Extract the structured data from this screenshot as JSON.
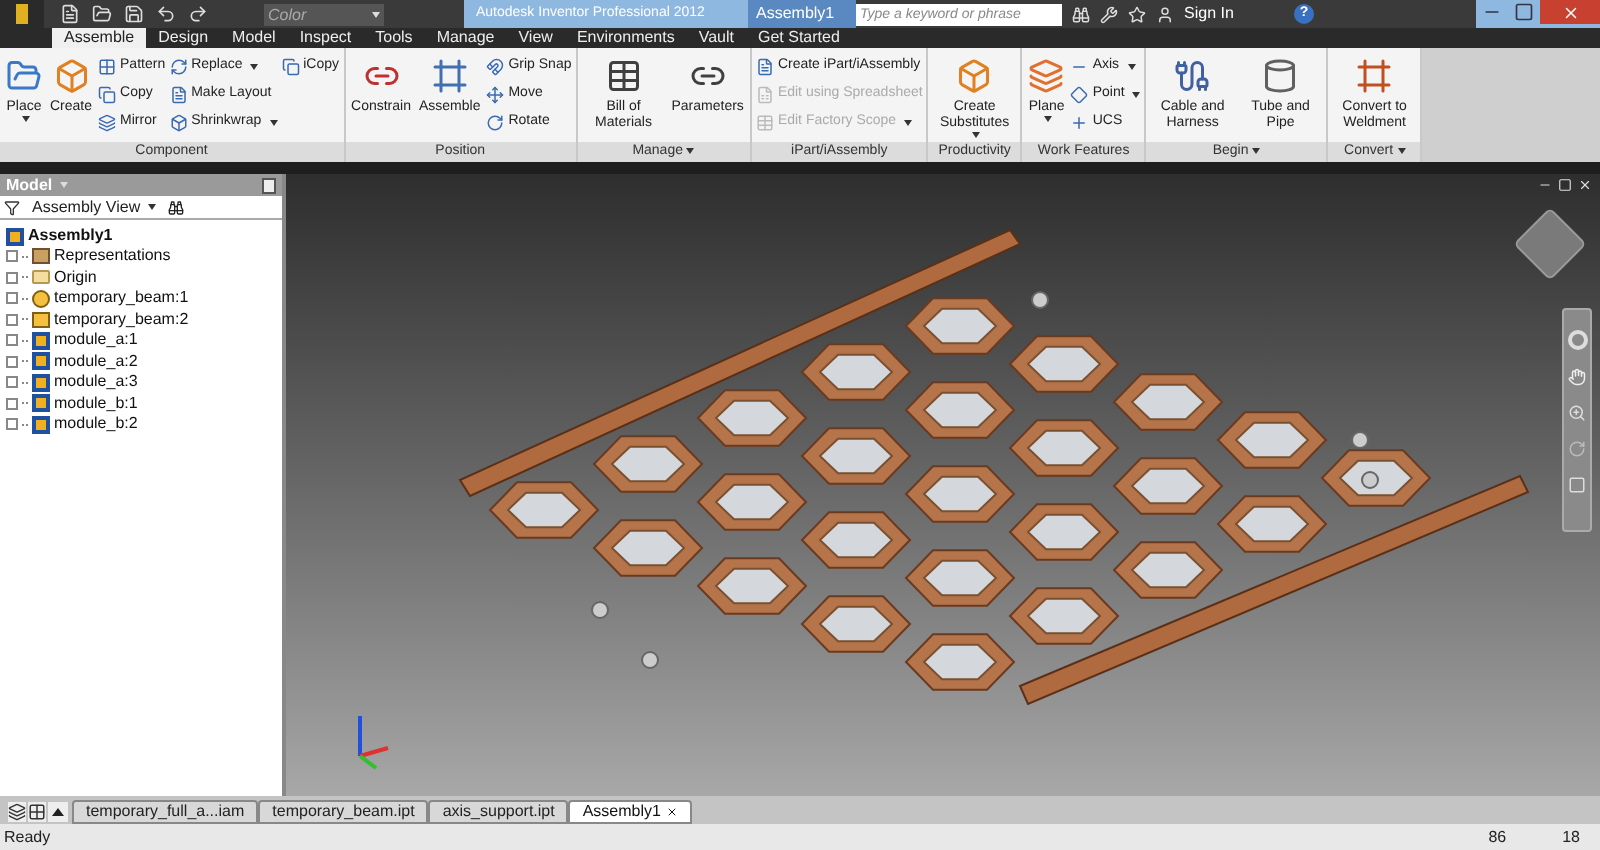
{
  "title_bar": {
    "color_field": "Color",
    "app_title": "Autodesk Inventor Professional 2012",
    "document_title": "Assembly1",
    "search_placeholder": "Type a keyword or phrase",
    "sign_in": "Sign In",
    "help": "?"
  },
  "ribbon_tabs": [
    {
      "label": "Assemble",
      "selected": true
    },
    {
      "label": "Design",
      "selected": false
    },
    {
      "label": "Model",
      "selected": false
    },
    {
      "label": "Inspect",
      "selected": false
    },
    {
      "label": "Tools",
      "selected": false
    },
    {
      "label": "Manage",
      "selected": false
    },
    {
      "label": "View",
      "selected": false
    },
    {
      "label": "Environments",
      "selected": false
    },
    {
      "label": "Vault",
      "selected": false
    },
    {
      "label": "Get Started",
      "selected": false
    }
  ],
  "panels": [
    {
      "title": "Component",
      "menu": false,
      "tools": [
        {
          "label": "Place",
          "kind": "large",
          "dropdown": true,
          "disabled": false
        },
        {
          "label": "Create",
          "kind": "large",
          "dropdown": false,
          "disabled": false
        },
        {
          "label": "Pattern",
          "kind": "small",
          "dropdown": false,
          "disabled": false
        },
        {
          "label": "Copy",
          "kind": "small",
          "dropdown": false,
          "disabled": false
        },
        {
          "label": "Mirror",
          "kind": "small",
          "dropdown": false,
          "disabled": false
        },
        {
          "label": "Replace",
          "kind": "small",
          "dropdown": true,
          "disabled": false
        },
        {
          "label": "Make Layout",
          "kind": "small",
          "dropdown": false,
          "disabled": false
        },
        {
          "label": "Shrinkwrap",
          "kind": "small",
          "dropdown": true,
          "disabled": false
        },
        {
          "label": "iCopy",
          "kind": "small",
          "dropdown": false,
          "disabled": false
        }
      ]
    },
    {
      "title": "Position",
      "menu": false,
      "tools": [
        {
          "label": "Constrain",
          "kind": "large",
          "dropdown": false,
          "disabled": false
        },
        {
          "label": "Assemble",
          "kind": "large",
          "dropdown": false,
          "disabled": false
        },
        {
          "label": "Grip Snap",
          "kind": "small",
          "dropdown": false,
          "disabled": false
        },
        {
          "label": "Move",
          "kind": "small",
          "dropdown": false,
          "disabled": false
        },
        {
          "label": "Rotate",
          "kind": "small",
          "dropdown": false,
          "disabled": false
        }
      ]
    },
    {
      "title": "Manage",
      "menu": true,
      "tools": [
        {
          "label": "Bill of Materials",
          "kind": "large",
          "dropdown": false,
          "disabled": false
        },
        {
          "label": "Parameters",
          "kind": "large",
          "dropdown": false,
          "disabled": false
        }
      ]
    },
    {
      "title": "iPart/iAssembly",
      "menu": false,
      "tools": [
        {
          "label": "Create iPart/iAssembly",
          "kind": "small",
          "dropdown": false,
          "disabled": false
        },
        {
          "label": "Edit using Spreadsheet",
          "kind": "small",
          "dropdown": false,
          "disabled": true
        },
        {
          "label": "Edit Factory Scope",
          "kind": "small",
          "dropdown": true,
          "disabled": true
        }
      ]
    },
    {
      "title": "Productivity",
      "menu": false,
      "tools": [
        {
          "label": "Create Substitutes",
          "kind": "large",
          "dropdown": true,
          "disabled": false
        }
      ]
    },
    {
      "title": "Work Features",
      "menu": false,
      "tools": [
        {
          "label": "Plane",
          "kind": "large",
          "dropdown": true,
          "disabled": false
        },
        {
          "label": "Axis",
          "kind": "small",
          "dropdown": true,
          "disabled": false
        },
        {
          "label": "Point",
          "kind": "small",
          "dropdown": true,
          "disabled": false
        },
        {
          "label": "UCS",
          "kind": "small",
          "dropdown": false,
          "disabled": false
        }
      ]
    },
    {
      "title": "Begin",
      "menu": true,
      "tools": [
        {
          "label": "Cable and Harness",
          "kind": "large",
          "dropdown": false,
          "disabled": false
        },
        {
          "label": "Tube and Pipe",
          "kind": "large",
          "dropdown": false,
          "disabled": false
        }
      ]
    },
    {
      "title": "Convert",
      "menu": true,
      "tools": [
        {
          "label": "Convert to Weldment",
          "kind": "large",
          "dropdown": false,
          "disabled": false
        }
      ]
    }
  ],
  "browser": {
    "title": "Model",
    "view": "Assembly View",
    "tree": {
      "label": "Assembly1",
      "children": [
        {
          "label": "Representations",
          "kind": "representations"
        },
        {
          "label": "Origin",
          "kind": "folder"
        },
        {
          "label": "temporary_beam:1",
          "kind": "part_adaptive"
        },
        {
          "label": "temporary_beam:2",
          "kind": "part"
        },
        {
          "label": "module_a:1",
          "kind": "assembly"
        },
        {
          "label": "module_a:2",
          "kind": "assembly"
        },
        {
          "label": "module_a:3",
          "kind": "assembly"
        },
        {
          "label": "module_b:1",
          "kind": "assembly"
        },
        {
          "label": "module_b:2",
          "kind": "assembly"
        }
      ]
    }
  },
  "document_tabs": [
    {
      "label": "temporary_full_a...iam",
      "selected": false
    },
    {
      "label": "temporary_beam.ipt",
      "selected": false
    },
    {
      "label": "axis_support.ipt",
      "selected": false
    },
    {
      "label": "Assembly1",
      "selected": true
    }
  ],
  "status_bar": {
    "text": "Ready",
    "count_1": "86",
    "count_2": "18"
  }
}
